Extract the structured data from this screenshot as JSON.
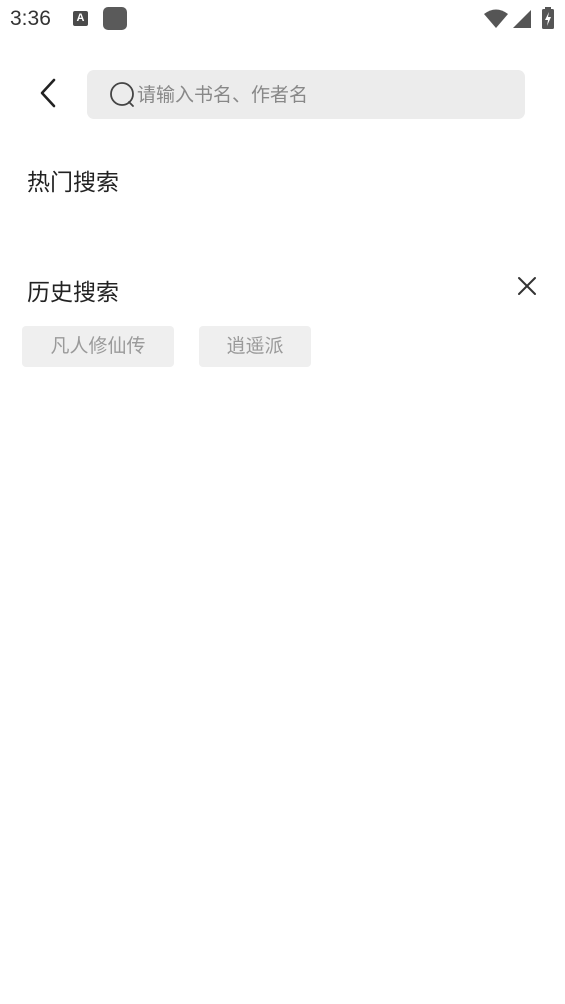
{
  "status_bar": {
    "time": "3:36",
    "notification_letter": "A"
  },
  "search": {
    "placeholder": "请输入书名、作者名",
    "value": ""
  },
  "hot_search": {
    "title": "热门搜索"
  },
  "history_search": {
    "title": "历史搜索",
    "items": [
      {
        "label": "凡人修仙传"
      },
      {
        "label": "逍遥派"
      }
    ]
  },
  "colors": {
    "background": "#ffffff",
    "search_bg": "#ececec",
    "tag_bg": "#efefef",
    "tag_text": "#9a9a9a",
    "title_text": "#222222"
  },
  "icons": {
    "back": "chevron-left-icon",
    "search": "magnifier-icon",
    "clear": "close-icon"
  }
}
